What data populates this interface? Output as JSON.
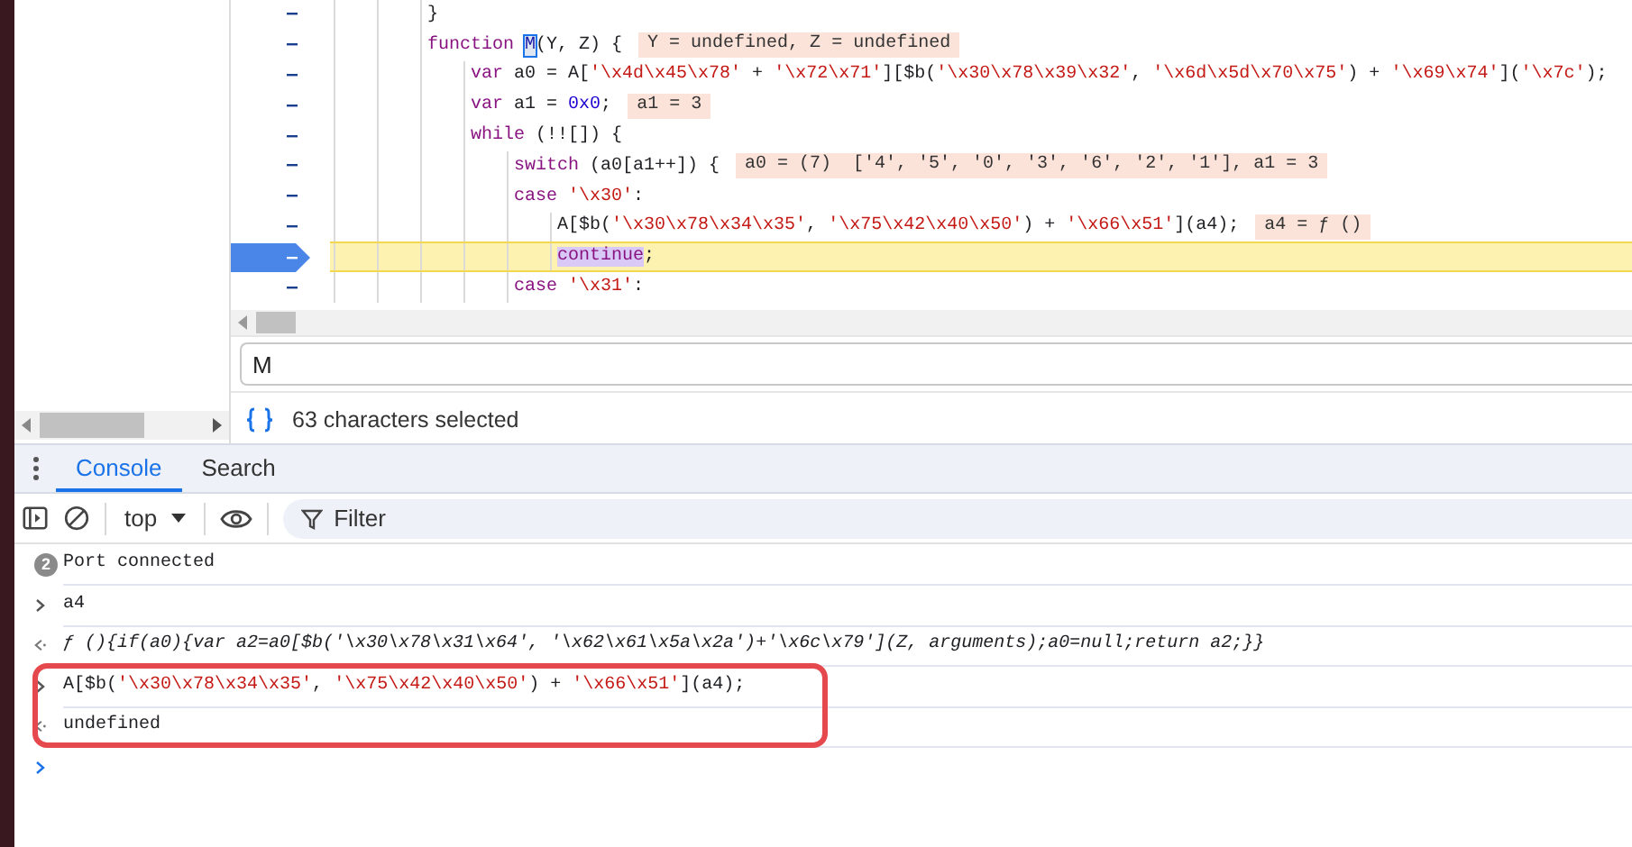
{
  "editor": {
    "lines": [
      {
        "current": false,
        "tokens": [
          {
            "text": "}",
            "kind": "plain"
          }
        ]
      },
      {
        "current": false,
        "tokens": [
          {
            "text": "function ",
            "kind": "keyword"
          },
          {
            "text": "M",
            "kind": "match"
          },
          {
            "text": "(Y, Z) {",
            "kind": "plain"
          }
        ],
        "inline_value": "Y = undefined, Z = undefined",
        "children": [
          {
            "current": false,
            "tokens": [
              {
                "text": "var",
                "kind": "keyword"
              },
              {
                "text": " a0 = A[",
                "kind": "plain"
              },
              {
                "text": "'\\x4d\\x45\\x78'",
                "kind": "string"
              },
              {
                "text": " + ",
                "kind": "plain"
              },
              {
                "text": "'\\x72\\x71'",
                "kind": "string"
              },
              {
                "text": "][$b(",
                "kind": "plain"
              },
              {
                "text": "'\\x30\\x78\\x39\\x32'",
                "kind": "string"
              },
              {
                "text": ", ",
                "kind": "plain"
              },
              {
                "text": "'\\x6d\\x5d\\x70\\x75'",
                "kind": "string"
              },
              {
                "text": ") + ",
                "kind": "plain"
              },
              {
                "text": "'\\x69\\x74'",
                "kind": "string"
              },
              {
                "text": "](",
                "kind": "plain"
              },
              {
                "text": "'\\x7c'",
                "kind": "string"
              },
              {
                "text": ");",
                "kind": "plain"
              }
            ]
          },
          {
            "current": false,
            "tokens": [
              {
                "text": "var",
                "kind": "keyword"
              },
              {
                "text": " a1 = ",
                "kind": "plain"
              },
              {
                "text": "0x0",
                "kind": "number"
              },
              {
                "text": ";",
                "kind": "plain"
              }
            ],
            "inline_value": "a1 = 3"
          },
          {
            "current": false,
            "tokens": [
              {
                "text": "while",
                "kind": "keyword"
              },
              {
                "text": " (!![]) {",
                "kind": "plain"
              }
            ],
            "children": [
              {
                "current": false,
                "tokens": [
                  {
                    "text": "switch",
                    "kind": "keyword"
                  },
                  {
                    "text": " (a0[a1++]) {",
                    "kind": "plain"
                  }
                ],
                "inline_value": "a0 = (7)  ['4', '5', '0', '3', '6', '2', '1'], a1 = 3"
              },
              {
                "current": false,
                "tokens": [
                  {
                    "text": "case ",
                    "kind": "keyword"
                  },
                  {
                    "text": "'\\x30'",
                    "kind": "string"
                  },
                  {
                    "text": ":",
                    "kind": "plain"
                  }
                ],
                "children": [
                  {
                    "current": false,
                    "tokens": [
                      {
                        "text": "A[$b(",
                        "kind": "plain"
                      },
                      {
                        "text": "'\\x30\\x78\\x34\\x35'",
                        "kind": "string"
                      },
                      {
                        "text": ", ",
                        "kind": "plain"
                      },
                      {
                        "text": "'\\x75\\x42\\x40\\x50'",
                        "kind": "string"
                      },
                      {
                        "text": ") + ",
                        "kind": "plain"
                      },
                      {
                        "text": "'\\x66\\x51'",
                        "kind": "string"
                      },
                      {
                        "text": "](a4);",
                        "kind": "plain"
                      }
                    ],
                    "inline_value": "a4 = ƒ ()"
                  },
                  {
                    "current": true,
                    "tokens": [
                      {
                        "text": "continue",
                        "kind": "selected"
                      },
                      {
                        "text": ";",
                        "kind": "plain"
                      }
                    ]
                  }
                ]
              },
              {
                "current": false,
                "tokens": [
                  {
                    "text": "case ",
                    "kind": "keyword"
                  },
                  {
                    "text": "'\\x31'",
                    "kind": "string"
                  },
                  {
                    "text": ":",
                    "kind": "plain"
                  }
                ]
              }
            ]
          }
        ]
      }
    ],
    "search": {
      "value": "M"
    },
    "status": {
      "text": "63 characters selected"
    }
  },
  "drawer": {
    "tabs": [
      {
        "label": "Console",
        "selected": true
      },
      {
        "label": "Search",
        "selected": false
      }
    ]
  },
  "console": {
    "toolbar": {
      "context": "top",
      "filter_placeholder": "Filter"
    },
    "messages": [
      {
        "kind": "log",
        "count": "2",
        "text": "Port connected",
        "framed": false
      },
      {
        "kind": "command",
        "tokens": [
          {
            "text": "a4",
            "kind": "plain"
          }
        ],
        "framed": false
      },
      {
        "kind": "function-result",
        "text": "ƒ (){if(a0){var a2=a0[$b('\\x30\\x78\\x31\\x64', '\\x62\\x61\\x5a\\x2a')+'\\x6c\\x79'](Z, arguments);a0=null;return a2;}}",
        "framed": false
      },
      {
        "kind": "command",
        "tokens": [
          {
            "text": "A[$b(",
            "kind": "plain"
          },
          {
            "text": "'\\x30\\x78\\x34\\x35'",
            "kind": "string"
          },
          {
            "text": ", ",
            "kind": "plain"
          },
          {
            "text": "'\\x75\\x42\\x40\\x50'",
            "kind": "string"
          },
          {
            "text": ") + ",
            "kind": "plain"
          },
          {
            "text": "'\\x66\\x51'",
            "kind": "string"
          },
          {
            "text": "](a4);",
            "kind": "plain"
          }
        ],
        "framed": true
      },
      {
        "kind": "undefined-result",
        "text": "undefined",
        "framed": true
      },
      {
        "kind": "prompt",
        "framed": false
      }
    ]
  }
}
